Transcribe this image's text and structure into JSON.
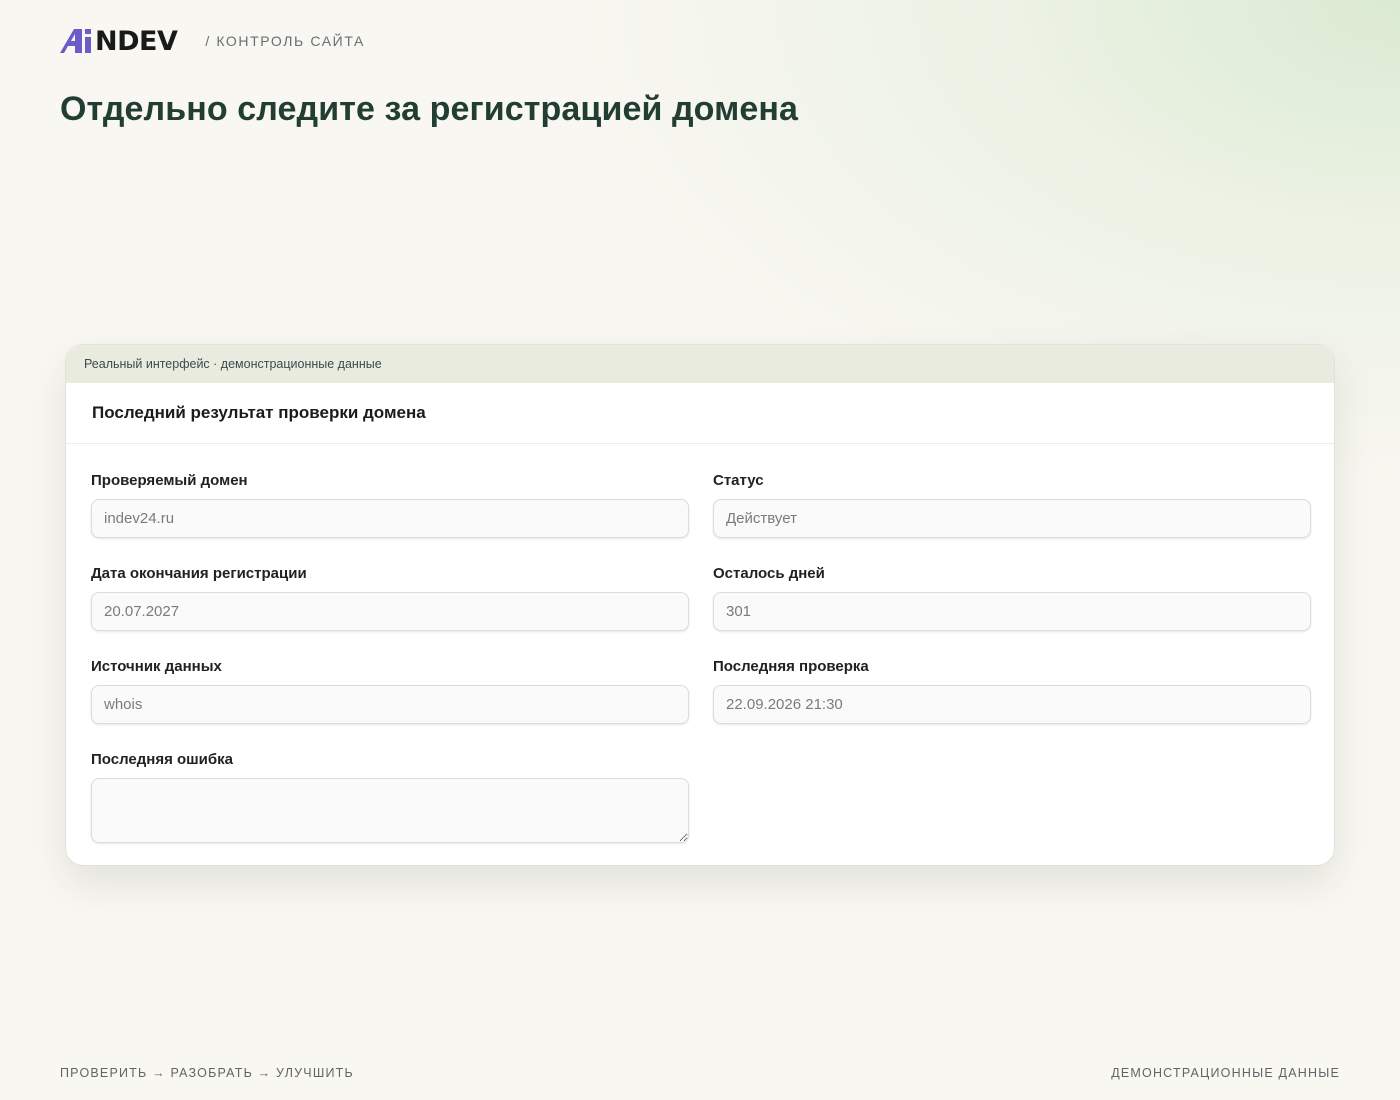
{
  "brand": {
    "logo_prefix": "Ai",
    "logo_rest": "NDEV",
    "section_label": "/ КОНТРОЛЬ САЙТА",
    "accent_color": "#6b5cc7"
  },
  "page": {
    "title": "Отдельно следите за регистрацией домена"
  },
  "card": {
    "strip_text": "Реальный интерфейс · демонстрационные данные",
    "header": "Последний результат проверки домена",
    "fields": {
      "domain": {
        "label": "Проверяемый домен",
        "value": "indev24.ru"
      },
      "status": {
        "label": "Статус",
        "value": "Действует"
      },
      "expiry": {
        "label": "Дата окончания регистрации",
        "value": "20.07.2027"
      },
      "days_left": {
        "label": "Осталось дней",
        "value": "301"
      },
      "source": {
        "label": "Источник данных",
        "value": "whois"
      },
      "last_check": {
        "label": "Последняя проверка",
        "value": "22.09.2026 21:30"
      },
      "last_error": {
        "label": "Последняя ошибка",
        "value": ""
      }
    }
  },
  "footer": {
    "left": "ПРОВЕРИТЬ → РАЗОБРАТЬ → УЛУЧШИТЬ",
    "right": "ДЕМОНСТРАЦИОННЫЕ ДАННЫЕ"
  }
}
